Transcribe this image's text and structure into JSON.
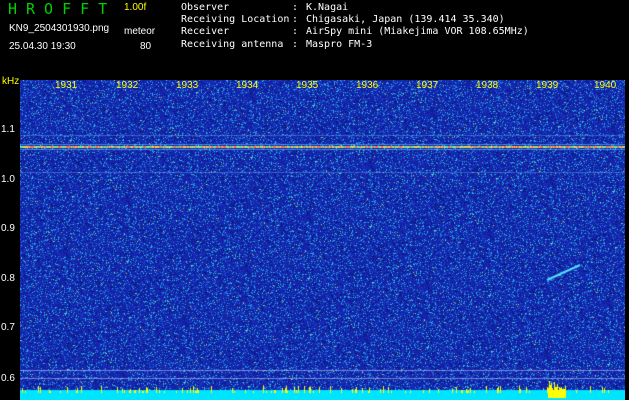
{
  "header": {
    "app_title": "HROFFT",
    "version": "1.00f",
    "filename": "KN9_2504301930.png",
    "datetime": "25.04.30 19:30",
    "mode_label": "meteor",
    "mode_value": "80"
  },
  "info": [
    {
      "key": "Observer",
      "sep": ":",
      "value": "K.Nagai"
    },
    {
      "key": "Receiving Location",
      "sep": ":",
      "value": "Chigasaki, Japan (139.414 35.340)"
    },
    {
      "key": "Receiver",
      "sep": ":",
      "value": "AirSpy mini (Miakejima VOR 108.65MHz)"
    },
    {
      "key": "Receiving antenna",
      "sep": ":",
      "value": "Maspro FM-3"
    }
  ],
  "axis": {
    "y_unit": "kHz",
    "y_ticks": [
      "1.1",
      "1.0",
      "0.9",
      "0.8",
      "0.7",
      "0.6"
    ],
    "x_ticks": [
      "1931",
      "1932",
      "1933",
      "1934",
      "1935",
      "1936",
      "1937",
      "1938",
      "1939",
      "1940"
    ]
  },
  "colors": {
    "background": "#000000",
    "title_green": "#00d000",
    "accent_yellow": "#ffff00",
    "spectrogram_bg": "#1a2bb0",
    "baseline_cyan": "#00e5ff",
    "carrier_line": "#ff6040"
  }
}
